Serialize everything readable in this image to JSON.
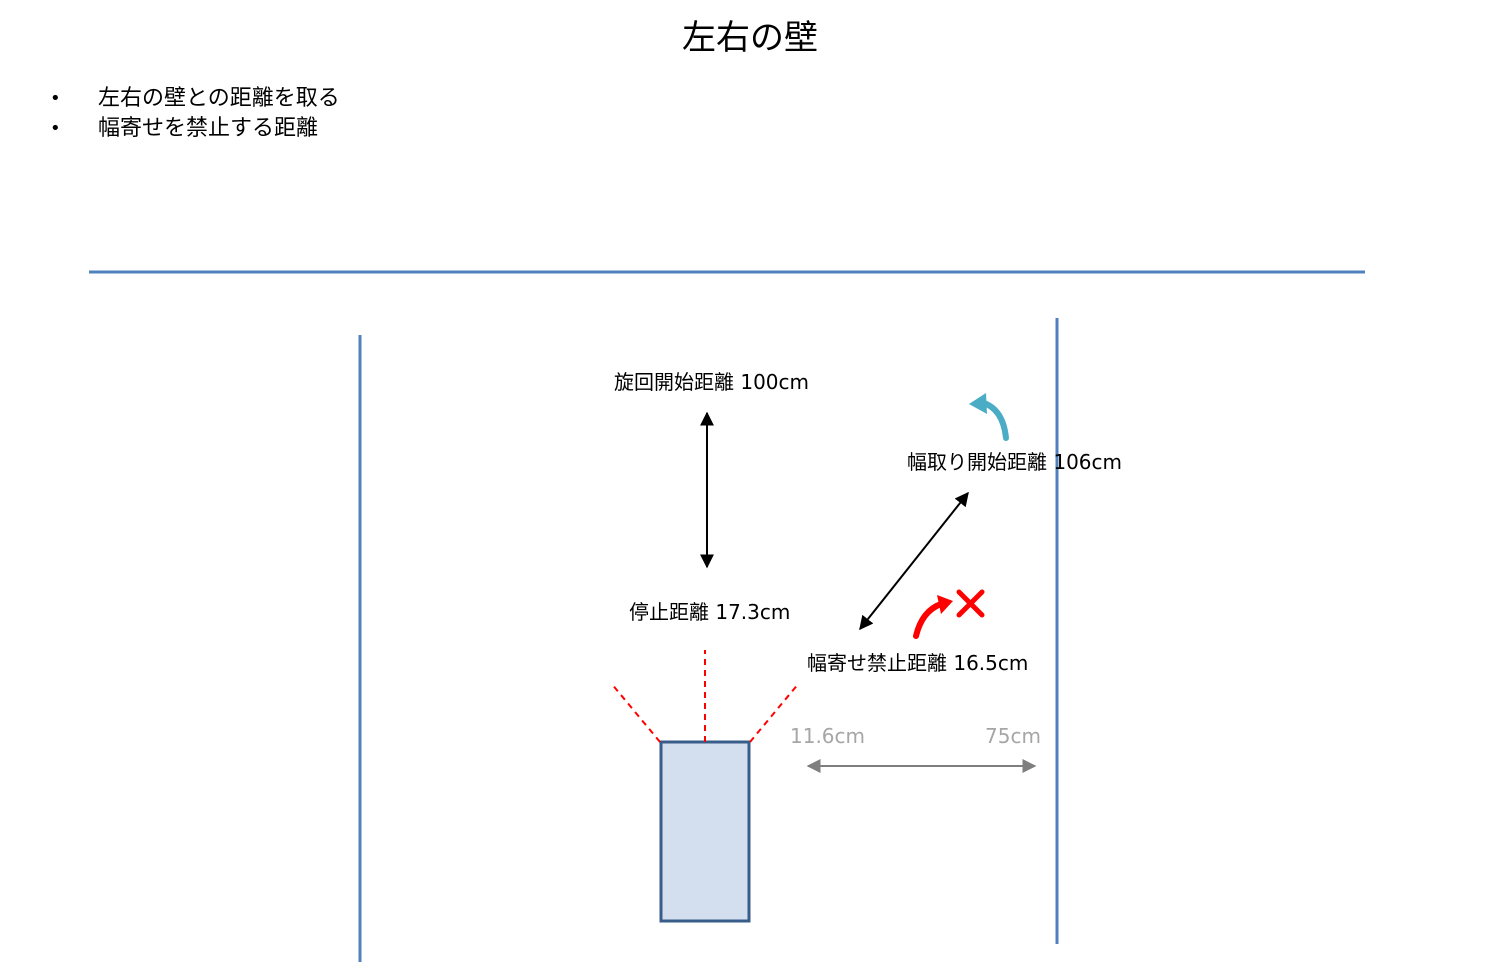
{
  "title": "左右の壁",
  "bullets": [
    "左右の壁との距離を取る",
    "幅寄せを禁止する距離"
  ],
  "labels": {
    "turn_start": "旋回開始距離 100cm",
    "width_start": "幅取り開始距離 106cm",
    "stop": "停止距離 17.3cm",
    "no_approach": "幅寄せ禁止距離 16.5cm",
    "dist_near": "11.6cm",
    "dist_far": "75cm"
  },
  "colors": {
    "wall": "#4f81bd",
    "robot_fill": "#d3dfee",
    "robot_border": "#385d8a",
    "sensor": "#ff0000",
    "arrow": "#000000",
    "gray_arrow": "#7f7f7f",
    "gray_text": "#a6a6a6",
    "teal_arrow": "#4bacc6",
    "red_arrow": "#ff0000"
  },
  "icons": {
    "forbidden": "cross-mark-icon",
    "allowed_turn": "curved-arrow-icon",
    "forbidden_turn": "curved-arrow-icon"
  }
}
